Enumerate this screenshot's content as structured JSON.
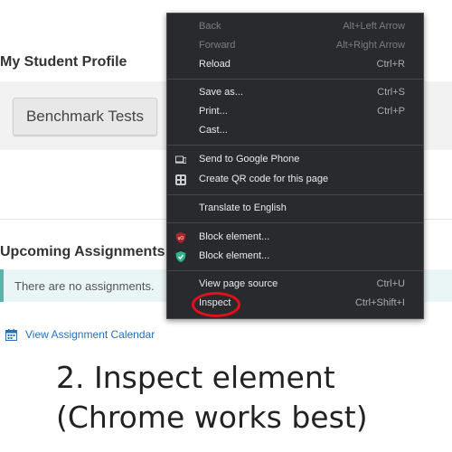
{
  "page": {
    "profile_title": "My Student Profile",
    "benchmark_button": "Benchmark Tests",
    "upcoming_title": "Upcoming Assignments",
    "no_assignments_text": "There are no assignments.",
    "calendar_link": "View Assignment Calendar"
  },
  "caption": {
    "line1": "2. Inspect element",
    "line2": "(Chrome works best)"
  },
  "context_menu": {
    "back": {
      "label": "Back",
      "shortcut": "Alt+Left Arrow"
    },
    "forward": {
      "label": "Forward",
      "shortcut": "Alt+Right Arrow"
    },
    "reload": {
      "label": "Reload",
      "shortcut": "Ctrl+R"
    },
    "save_as": {
      "label": "Save as...",
      "shortcut": "Ctrl+S"
    },
    "print": {
      "label": "Print...",
      "shortcut": "Ctrl+P"
    },
    "cast": {
      "label": "Cast..."
    },
    "send_to_phone": {
      "label": "Send to Google Phone",
      "icon": "phone-laptop-icon"
    },
    "qr_code": {
      "label": "Create QR code for this page",
      "icon": "qr-code-icon"
    },
    "translate": {
      "label": "Translate to English"
    },
    "block_ublock": {
      "label": "Block element...",
      "icon": "ublock-origin-icon"
    },
    "block_adguard": {
      "label": "Block element...",
      "icon": "adguard-shield-icon"
    },
    "view_source": {
      "label": "View page source",
      "shortcut": "Ctrl+U"
    },
    "inspect": {
      "label": "Inspect",
      "shortcut": "Ctrl+Shift+I"
    }
  },
  "colors": {
    "menu_bg": "#292a2d",
    "highlight_ring": "#e3101a",
    "notice_accent": "#5ab4ac",
    "link": "#2a6fb8"
  }
}
